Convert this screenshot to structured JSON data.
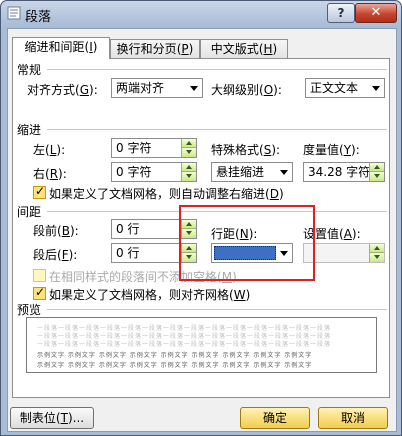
{
  "window": {
    "title": "段落",
    "help_symbol": "?",
    "close_symbol": "✕"
  },
  "tabs": [
    {
      "label": "缩进和间距",
      "key": "I",
      "active": true
    },
    {
      "label": "换行和分页",
      "key": "P",
      "active": false
    },
    {
      "label": "中文版式",
      "key": "H",
      "active": false
    }
  ],
  "general": {
    "section_title": "常规",
    "alignment_label": "对齐方式",
    "alignment_key": "G",
    "alignment_value": "两端对齐",
    "outline_label": "大纲级别",
    "outline_key": "O",
    "outline_value": "正文文本"
  },
  "indent": {
    "section_title": "缩进",
    "left_label": "左",
    "left_key": "L",
    "left_value": "0 字符",
    "right_label": "右",
    "right_key": "R",
    "right_value": "0 字符",
    "special_label": "特殊格式",
    "special_key": "S",
    "special_value": "悬挂缩进",
    "measure_label": "度量值",
    "measure_key": "Y",
    "measure_value": "34.28 字符",
    "auto_adjust_label": "如果定义了文档网格，则自动调整右缩进",
    "auto_adjust_key": "D",
    "auto_adjust_checked": true
  },
  "spacing": {
    "section_title": "间距",
    "before_label": "段前",
    "before_key": "B",
    "before_value": "0 行",
    "after_label": "段后",
    "after_key": "F",
    "after_value": "0 行",
    "line_label": "行距",
    "line_key": "N",
    "line_value": "",
    "setting_label": "设置值",
    "setting_key": "A",
    "setting_value": "",
    "no_space_label": "在相同样式的段落间不添加空格",
    "no_space_key": "M",
    "no_space_checked": false,
    "snap_grid_label": "如果定义了文档网格，则对齐网格",
    "snap_grid_key": "W",
    "snap_grid_checked": true
  },
  "preview": {
    "section_title": "预览",
    "grey_text": "一段落一段落一段落一段落一段落一段落一段落一段落一段落一段落一段落一段落一段落一段落",
    "sample_text": "示例文字 示例文字 示例文字 示例文字 示例文字 示例文字 示例文字 示例文字 示例文字"
  },
  "buttons": {
    "tabs": "制表位",
    "tabs_key": "T",
    "ok": "确定",
    "cancel": "取消"
  },
  "colors": {
    "highlight": "#e02020",
    "accent_gold": "#f2cc4e",
    "spin_green": "#c9e88a",
    "selection": "#3d6fc2"
  }
}
